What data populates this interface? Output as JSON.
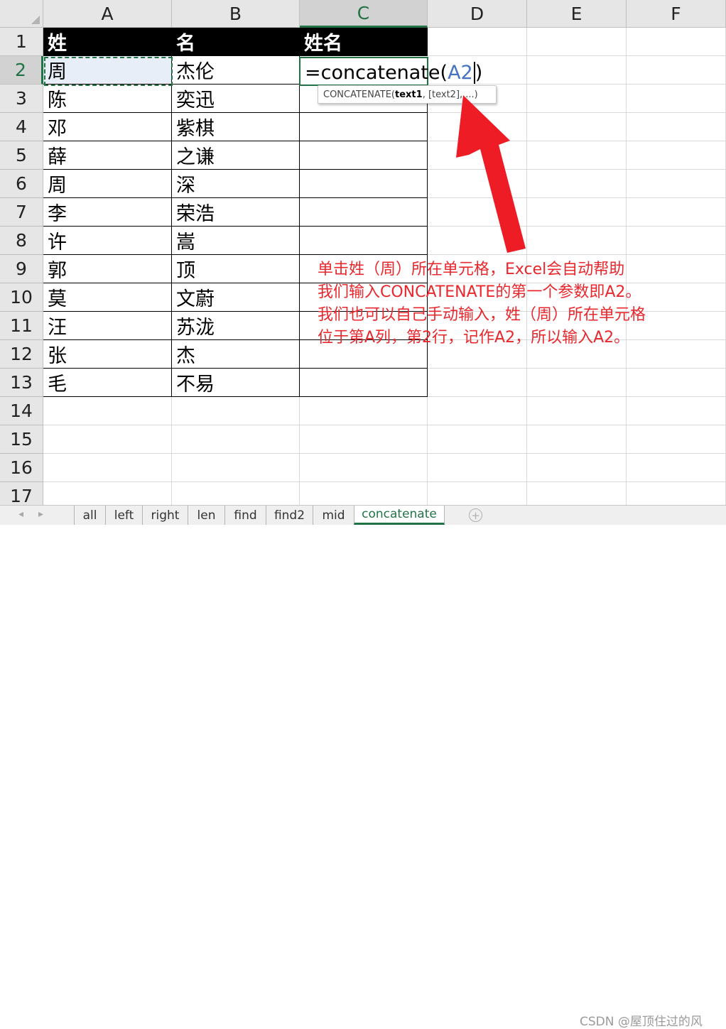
{
  "columns": [
    "A",
    "B",
    "C",
    "D",
    "E",
    "F"
  ],
  "active_column": "C",
  "rows": [
    "1",
    "2",
    "3",
    "4",
    "5",
    "6",
    "7",
    "8",
    "9",
    "10",
    "11",
    "12",
    "13",
    "14",
    "15",
    "16",
    "17"
  ],
  "active_row": "2",
  "header_row": [
    "姓",
    "名",
    "姓名"
  ],
  "data_rows": [
    [
      "周",
      "杰伦"
    ],
    [
      "陈",
      "奕迅"
    ],
    [
      "邓",
      "紫棋"
    ],
    [
      "薛",
      "之谦"
    ],
    [
      "周",
      "深"
    ],
    [
      "李",
      "荣浩"
    ],
    [
      "许",
      "嵩"
    ],
    [
      "郭",
      "顶"
    ],
    [
      "莫",
      "文蔚"
    ],
    [
      "汪",
      "苏泷"
    ],
    [
      "张",
      "杰"
    ],
    [
      "毛",
      "不易"
    ]
  ],
  "formula": {
    "prefix": "=concatenate(",
    "reference": "A2",
    "suffix": ")"
  },
  "tooltip": {
    "func": "CONCATENATE(",
    "arg1": "text1",
    "rest": ", [text2], ...)"
  },
  "annotation": [
    "单击姓（周）所在单元格，Excel会自动帮助",
    "我们输入CONCATENATE的第一个参数即A2。",
    "我们也可以自己手动输入，姓（周）所在单元格",
    "位于第A列，第2行，记作A2，所以输入A2。"
  ],
  "sheet_tabs": [
    "all",
    "left",
    "right",
    "len",
    "find",
    "find2",
    "mid",
    "concatenate"
  ],
  "active_tab": "concatenate",
  "watermark": "CSDN @屋顶住过的风",
  "colors": {
    "excel_green": "#217346",
    "annotation_red": "#e8282d",
    "arrow_red": "#ee1c25",
    "reference_blue": "#4472c4"
  }
}
